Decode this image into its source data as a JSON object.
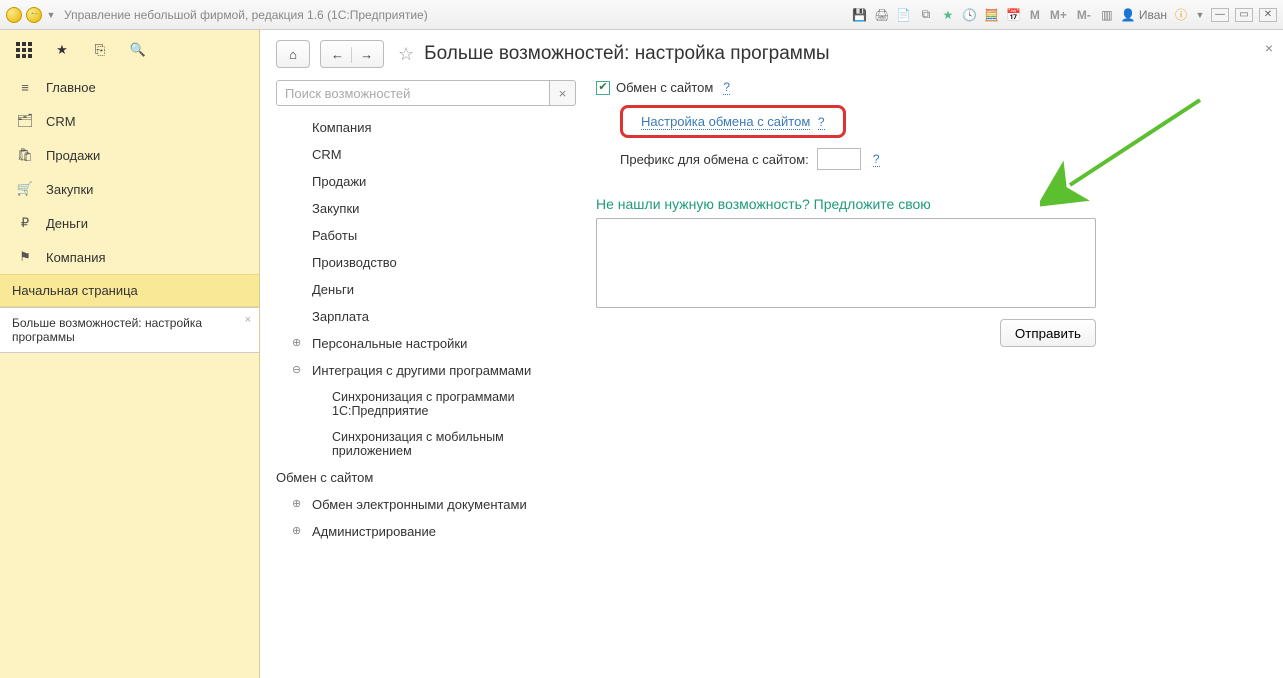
{
  "titlebar": {
    "title": "Управление небольшой фирмой, редакция 1.6  (1С:Предприятие)",
    "user": "Иван",
    "m_labels": [
      "M",
      "M+",
      "M-"
    ]
  },
  "sidebar": {
    "nav": [
      {
        "label": "Главное"
      },
      {
        "label": "CRM"
      },
      {
        "label": "Продажи"
      },
      {
        "label": "Закупки"
      },
      {
        "label": "Деньги"
      },
      {
        "label": "Компания"
      }
    ],
    "section": "Начальная страница",
    "active_tab": "Больше возможностей: настройка программы"
  },
  "content": {
    "page_title": "Больше возможностей: настройка программы",
    "search_placeholder": "Поиск возможностей",
    "tree": {
      "items": [
        {
          "label": "Компания"
        },
        {
          "label": "CRM"
        },
        {
          "label": "Продажи"
        },
        {
          "label": "Закупки"
        },
        {
          "label": "Работы"
        },
        {
          "label": "Производство"
        },
        {
          "label": "Деньги"
        },
        {
          "label": "Зарплата"
        }
      ],
      "personal": "Персональные настройки",
      "integration": "Интеграция с другими программами",
      "integration_children": [
        "Синхронизация с программами 1С:Предприятие",
        "Синхронизация с мобильным приложением",
        "Обмен с сайтом"
      ],
      "edoc": "Обмен электронными документами",
      "admin": "Администрирование"
    },
    "right": {
      "checkbox_label": "Обмен с сайтом",
      "config_link": "Настройка обмена с сайтом",
      "prefix_label": "Префикс для обмена с сайтом:",
      "help": "?",
      "suggest_label": "Не нашли нужную возможность? Предложите свою",
      "submit": "Отправить"
    }
  }
}
